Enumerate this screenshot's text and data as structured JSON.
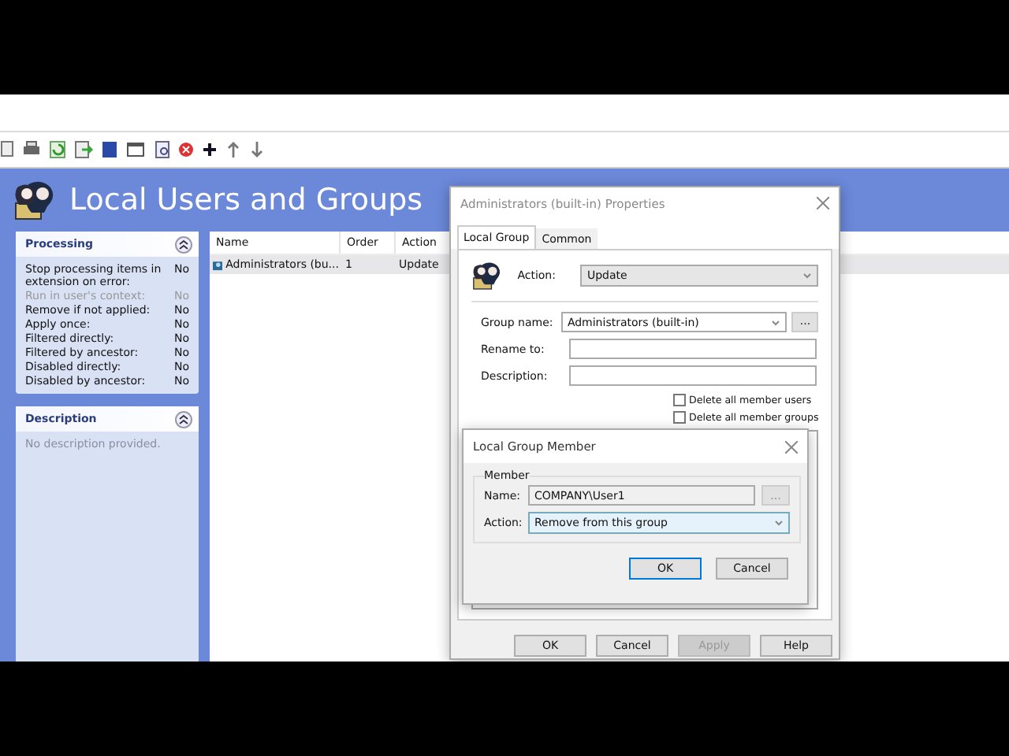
{
  "app": {
    "title": "Local Users and Groups"
  },
  "processing": {
    "title": "Processing",
    "rows": [
      {
        "label": "Stop processing items in extension on error:",
        "value": "No",
        "disabled": false
      },
      {
        "label": "Run in user's context:",
        "value": "No",
        "disabled": true
      },
      {
        "label": "Remove if not applied:",
        "value": "No",
        "disabled": false
      },
      {
        "label": "Apply once:",
        "value": "No",
        "disabled": false
      },
      {
        "label": "Filtered directly:",
        "value": "No",
        "disabled": false
      },
      {
        "label": "Filtered by ancestor:",
        "value": "No",
        "disabled": false
      },
      {
        "label": "Disabled directly:",
        "value": "No",
        "disabled": false
      },
      {
        "label": "Disabled by ancestor:",
        "value": "No",
        "disabled": false
      }
    ]
  },
  "description": {
    "title": "Description",
    "text": "No description provided."
  },
  "table": {
    "columns": [
      "Name",
      "Order",
      "Action"
    ],
    "rows": [
      {
        "cells": [
          "Administrators (bu...",
          "1",
          "Update"
        ],
        "selected": true
      }
    ]
  },
  "properties_dialog": {
    "title": "Administrators (built-in) Properties",
    "tabs": [
      {
        "label": "Local Group",
        "selected": true
      },
      {
        "label": "Common",
        "selected": false
      }
    ],
    "action_label": "Action:",
    "action_value": "Update",
    "fields": [
      {
        "label": "Group name:",
        "value": "Administrators (built-in)",
        "kind": "combo",
        "browse": "..."
      },
      {
        "label": "Rename to:",
        "kind": "text"
      },
      {
        "label": "Description:",
        "kind": "text"
      }
    ],
    "checkboxes": [
      {
        "label": "Delete all member users",
        "checked": false
      },
      {
        "label": "Delete all member groups",
        "checked": false
      }
    ],
    "buttons": [
      {
        "label": "OK",
        "disabled": false
      },
      {
        "label": "Cancel",
        "disabled": false
      },
      {
        "label": "Apply",
        "disabled": true
      },
      {
        "label": "Help",
        "disabled": false
      }
    ]
  },
  "member_dialog": {
    "title": "Local Group Member",
    "group": "Member",
    "name_label": "Name:",
    "name_value": "COMPANY\\User1",
    "browse": "...",
    "action_label": "Action:",
    "action_value": "Remove from this group",
    "buttons": [
      {
        "label": "OK",
        "default": true
      },
      {
        "label": "Cancel",
        "default": false
      }
    ]
  }
}
